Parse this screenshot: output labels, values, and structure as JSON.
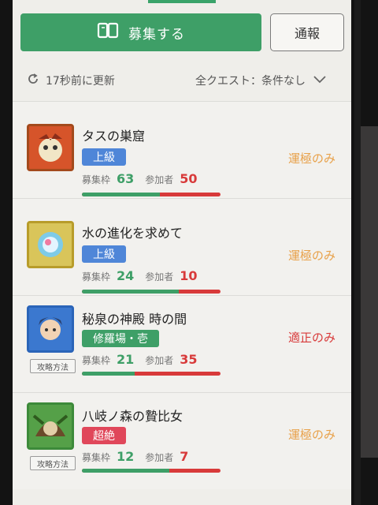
{
  "header": {
    "recruit_label": "募集する",
    "report_label": "通報"
  },
  "status": {
    "updated_text": "17秒前に更新",
    "filter_text": "全クエスト：条件なし"
  },
  "colors": {
    "green": "#3e9f67",
    "red": "#d83a3a",
    "orange": "#e8a14a",
    "badge_blue": "#4f86d8"
  },
  "quests": [
    {
      "title": "タスの巣窟",
      "badge": "上級",
      "badge_color": "#4f86d8",
      "slots_label": "募集枠",
      "slots": "63",
      "participants_label": "参加者",
      "participants": "50",
      "fill_fraction": 0.56,
      "condition": "運極のみ",
      "condition_color": "#e8a14a",
      "guide": ""
    },
    {
      "title": "水の進化を求めて",
      "badge": "上級",
      "badge_color": "#4f86d8",
      "slots_label": "募集枠",
      "slots": "24",
      "participants_label": "参加者",
      "participants": "10",
      "fill_fraction": 0.7,
      "condition": "運極のみ",
      "condition_color": "#e8a14a",
      "guide": ""
    },
    {
      "title": "秘泉の神殿 時の間",
      "badge": "修羅場・壱",
      "badge_color": "#3e9f67",
      "slots_label": "募集枠",
      "slots": "21",
      "participants_label": "参加者",
      "participants": "35",
      "fill_fraction": 0.38,
      "condition": "適正のみ",
      "condition_color": "#d83a3a",
      "guide": "攻略方法"
    },
    {
      "title": "八岐ノ森の贄比女",
      "badge": "超絶",
      "badge_color": "#e0475a",
      "slots_label": "募集枠",
      "slots": "12",
      "participants_label": "参加者",
      "participants": "7",
      "fill_fraction": 0.63,
      "condition": "運極のみ",
      "condition_color": "#e8a14a",
      "guide": "攻略方法"
    }
  ]
}
